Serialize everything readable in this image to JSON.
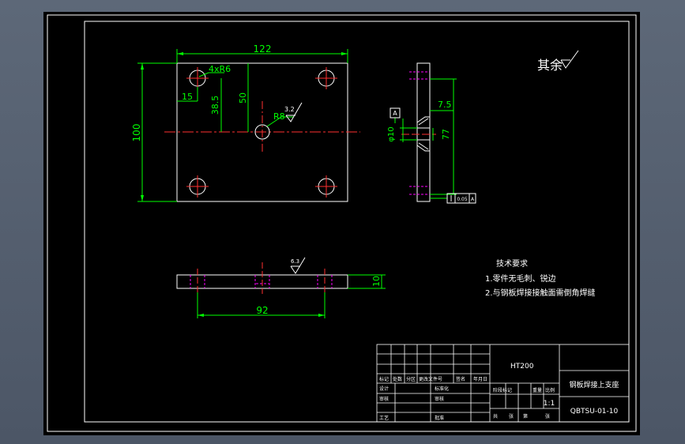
{
  "drawing": {
    "top_view": {
      "dim_width": "122",
      "dim_height": "100",
      "hole_callout": "4xR6",
      "dim_hole_x": "15",
      "dim_hole_y": "38.5",
      "dim_center_y": "50",
      "center_hole_radius": "R8",
      "roughness_center": "3.2"
    },
    "side_view": {
      "datum_label": "A",
      "dim_offset": "7.5",
      "dim_spacing": "77",
      "dim_dia": "φ10",
      "tolerance_value": "0.05",
      "tolerance_datum": "A"
    },
    "front_view": {
      "dim_thickness": "10",
      "dim_hole_spacing": "92",
      "roughness": "6.3"
    },
    "other_roughness_label": "其余",
    "tech_requirements": {
      "title": "技术要求",
      "items": [
        "1.零件无毛刺、锐边",
        "2.与钢板焊接接触面需倒角焊缝"
      ]
    },
    "title_block": {
      "material": "HT200",
      "part_name": "钢板焊接上支座",
      "drawing_number": "QBTSU-01-10",
      "scale": "1:1",
      "header_row": [
        "标记",
        "处数",
        "分区",
        "更改文件号",
        "签名",
        "年月日"
      ],
      "row_labels": [
        "设计",
        "审核",
        "工艺"
      ],
      "mid_labels": [
        "标准化",
        "审核",
        "批准"
      ],
      "stage_headers": [
        "阶段标记",
        "重量",
        "比例"
      ],
      "sheet_info": [
        "共",
        "张",
        "第",
        "张"
      ]
    }
  }
}
